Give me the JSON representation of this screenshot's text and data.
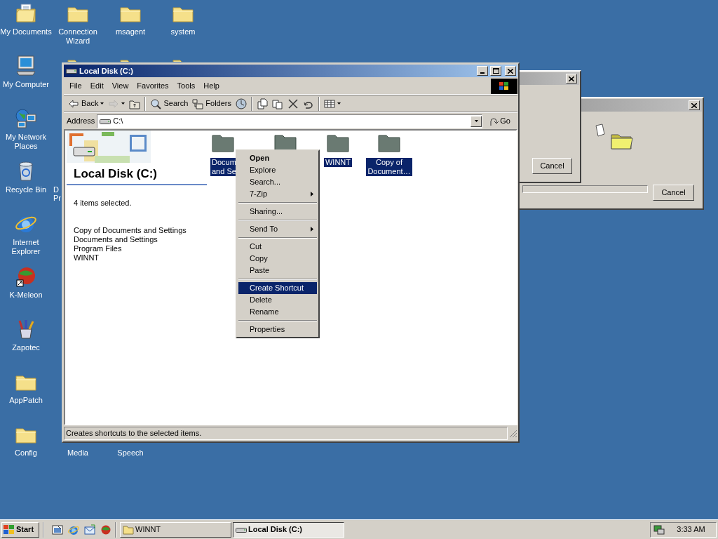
{
  "desktop_icons": [
    {
      "label": "My Documents",
      "kind": "mydocs"
    },
    {
      "label": "My Computer",
      "kind": "computer"
    },
    {
      "label": "My Network Places",
      "kind": "network"
    },
    {
      "label": "Recycle Bin",
      "kind": "recycle"
    },
    {
      "label": "Internet Explorer",
      "kind": "ie"
    },
    {
      "label": "K-Meleon",
      "kind": "kmeleon"
    },
    {
      "label": "Zapotec",
      "kind": "zapotec"
    },
    {
      "label": "AppPatch",
      "kind": "folder"
    },
    {
      "label": "Config",
      "kind": "folder"
    },
    {
      "label": "Connection Wizard",
      "kind": "folder"
    },
    {
      "label": "msagent",
      "kind": "folder"
    },
    {
      "label": "system",
      "kind": "folder"
    },
    {
      "kind": "folder"
    },
    {
      "kind": "folder"
    },
    {
      "kind": "folder"
    },
    {
      "label_lines": [
        "D",
        "Pr"
      ],
      "kind": "none"
    },
    {
      "label": "Media",
      "kind": "none"
    },
    {
      "label": "Speech",
      "kind": "none"
    }
  ],
  "dialogs": [
    {
      "kind": "plain",
      "button": "Cancel"
    },
    {
      "kind": "copying",
      "button": "Cancel",
      "level": 0
    }
  ],
  "window": {
    "title": "Local Disk (C:)",
    "menu": [
      "File",
      "Edit",
      "View",
      "Favorites",
      "Tools",
      "Help"
    ],
    "toolbar": [
      [
        {
          "kind": "back",
          "label": "Back",
          "disabled": false
        },
        {
          "kind": "forward",
          "disabled": true
        },
        {
          "kind": "up",
          "disabled": false
        }
      ],
      [
        {
          "kind": "search",
          "label": "Search",
          "disabled": false
        },
        {
          "kind": "folders",
          "label": "Folders",
          "disabled": false
        },
        {
          "kind": "history",
          "disabled": false
        }
      ],
      [
        {
          "kind": "moveto",
          "disabled": false
        },
        {
          "kind": "copyto",
          "disabled": false
        },
        {
          "kind": "delete",
          "disabled": false
        },
        {
          "kind": "undo",
          "disabled": false
        }
      ],
      [
        {
          "kind": "views",
          "disabled": false
        }
      ]
    ],
    "address": {
      "label": "Address",
      "value": "C:\\",
      "go": "Go"
    },
    "pane": {
      "title": "Local Disk (C:)",
      "summary": "4 items selected.",
      "names": [
        "Copy of Documents and Settings",
        "Documents and Settings",
        "Program Files",
        "WINNT"
      ]
    },
    "items": [
      {
        "label_lines": [
          "Docum",
          "and Se"
        ],
        "selected": true
      },
      {
        "selected": true
      },
      {
        "label_lines": [
          "WINNT"
        ],
        "selected": true
      },
      {
        "label_lines": [
          "Copy of",
          "Document…"
        ],
        "selected": true
      }
    ],
    "context_menu": [
      {
        "kind": "item",
        "label": "Open",
        "default": true,
        "submenu": false,
        "selected": false
      },
      {
        "kind": "item",
        "label": "Explore",
        "default": false,
        "submenu": false,
        "selected": false
      },
      {
        "kind": "item",
        "label": "Search...",
        "default": false,
        "submenu": false,
        "selected": false
      },
      {
        "kind": "item",
        "label": "7-Zip",
        "default": false,
        "submenu": true,
        "selected": false
      },
      {
        "kind": "separator"
      },
      {
        "kind": "item",
        "label": "Sharing...",
        "default": false,
        "submenu": false,
        "selected": false
      },
      {
        "kind": "separator"
      },
      {
        "kind": "item",
        "label": "Send To",
        "default": false,
        "submenu": true,
        "selected": false
      },
      {
        "kind": "separator"
      },
      {
        "kind": "item",
        "label": "Cut",
        "default": false,
        "submenu": false,
        "selected": false
      },
      {
        "kind": "item",
        "label": "Copy",
        "default": false,
        "submenu": false,
        "selected": false
      },
      {
        "kind": "item",
        "label": "Paste",
        "default": false,
        "submenu": false,
        "selected": false
      },
      {
        "kind": "separator"
      },
      {
        "kind": "item",
        "label": "Create Shortcut",
        "default": false,
        "submenu": false,
        "selected": true
      },
      {
        "kind": "item",
        "label": "Delete",
        "default": false,
        "submenu": false,
        "selected": false
      },
      {
        "kind": "item",
        "label": "Rename",
        "default": false,
        "submenu": false,
        "selected": false
      },
      {
        "kind": "separator"
      },
      {
        "kind": "item",
        "label": "Properties",
        "default": false,
        "submenu": false,
        "selected": false
      }
    ],
    "status": "Creates shortcuts to the selected items."
  },
  "taskbar": {
    "start": "Start",
    "quick_launch": [
      {
        "kind": "desktop"
      },
      {
        "kind": "ie"
      },
      {
        "kind": "mail"
      },
      {
        "kind": "kmeleon"
      }
    ],
    "tasks": [
      {
        "label": "WINNT",
        "kind": "folder",
        "selected": false
      },
      {
        "label": "Local Disk (C:)",
        "kind": "drive",
        "selected": true
      }
    ],
    "clock": "3:33 AM"
  }
}
